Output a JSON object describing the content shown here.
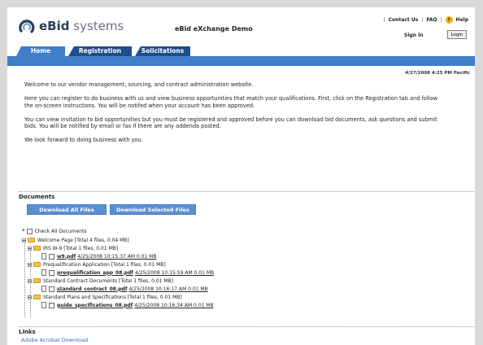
{
  "header": {
    "logo_brand": "eBid",
    "logo_suffix": " systems",
    "site_title": "eBid eXchange Demo",
    "contact_us": "Contact Us",
    "faq": "FAQ",
    "help": "Help",
    "sign_in_label": "Sign In",
    "login_button": "Login"
  },
  "tabs": [
    {
      "label": "Home",
      "active": true
    },
    {
      "label": "Registration",
      "active": false
    },
    {
      "label": "Solicitations",
      "active": false
    }
  ],
  "datetime": "4/27/2008 4:25 PM Pacific",
  "intro": {
    "p1": "Welcome to our vendor management, sourcing, and contract administration website.",
    "p2": "Here you can register to do business with us and view business opportunities that match your qualifications. First, click on the Registration tab and follow the on-screen instructions. You will be notifed when your account has been approved.",
    "p3": "You can view invitation to bid opportunities but you must be registered and approved before you can download bid documents, ask questions and submit bids. You will be notified by email or fax if there are any addenda posted.",
    "p4": "We look forward to doing business with you."
  },
  "documents": {
    "heading": "Documents",
    "download_all": "Download All Files",
    "download_selected": "Download Selected Files",
    "check_all": "Check All Documents",
    "root": "Welcome Page [Total 4 files, 0.04 MB]",
    "folders": [
      {
        "label": "IRS W-9 [Total 1 files, 0.01 MB]",
        "file": "w9.pdf",
        "meta": "4/25/2008 10:15:37 AM 0.01 MB"
      },
      {
        "label": "Prequalification Application [Total 1 files, 0.01 MB]",
        "file": "prequalification_app_08.pdf",
        "meta": "4/25/2008 10:15:59 AM 0.01 MB"
      },
      {
        "label": "Standard Contract Documents [Total 1 files, 0.01 MB]",
        "file": "standard_contract_08.pdf",
        "meta": "4/25/2008 10:16:17 AM 0.01 MB"
      },
      {
        "label": "Standard Plans and Specifications [Total 1 files, 0.01 MB]",
        "file": "guide_specifications_08.pdf",
        "meta": "4/25/2008 10:16:34 AM 0.01 MB"
      }
    ]
  },
  "links": {
    "heading": "Links",
    "adobe": "Adobe Acrobat Download"
  },
  "colors": {
    "tab_active": "#3f7ec8",
    "tab_inactive": "#1f4e8c",
    "button": "#5b8fd0",
    "link": "#3a6ab8"
  }
}
